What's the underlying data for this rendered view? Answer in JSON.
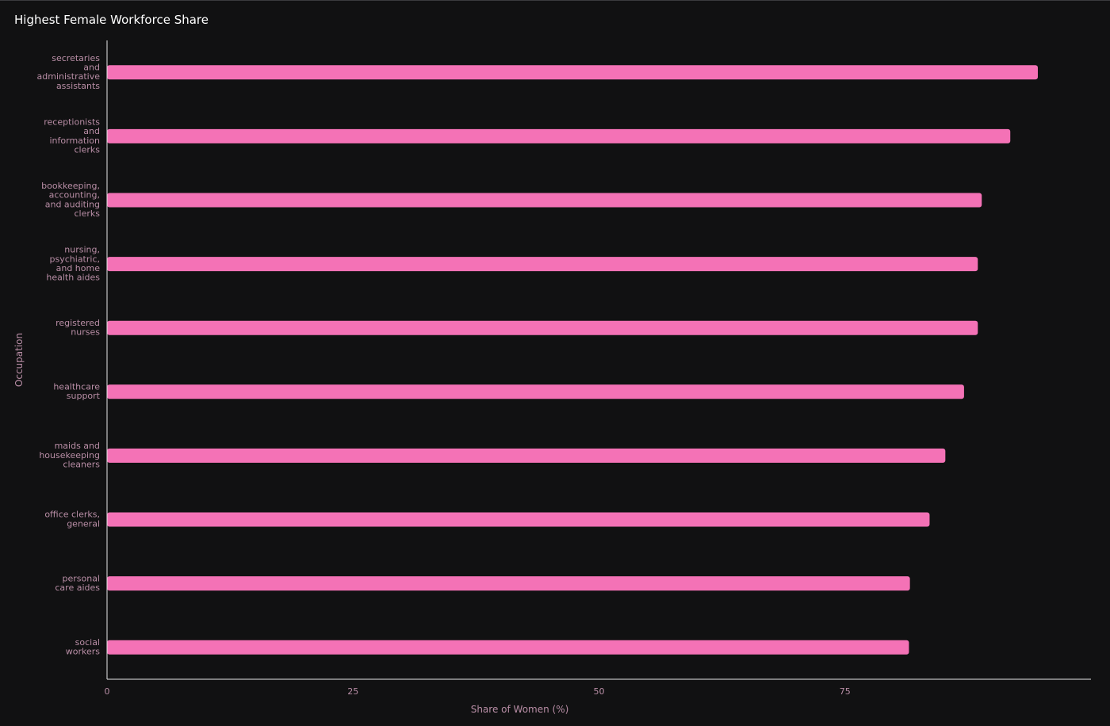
{
  "chart_data": {
    "type": "bar",
    "orientation": "horizontal",
    "title": "Highest Female Workforce Share",
    "xlabel": "Share of Women (%)",
    "ylabel": "Occupation",
    "xlim": [
      0,
      100
    ],
    "x_ticks": [
      "0",
      "25",
      "50",
      "75"
    ],
    "bar_color": "#f472b6",
    "grid": false,
    "legend": "none",
    "categories": [
      [
        "secretaries",
        "and",
        "administrative",
        "assistants"
      ],
      [
        "receptionists",
        "and",
        "information",
        "clerks"
      ],
      [
        "bookkeeping,",
        "accounting,",
        "and auditing",
        "clerks"
      ],
      [
        "nursing,",
        "psychiatric,",
        "and home",
        "health aides"
      ],
      [
        "registered",
        "nurses"
      ],
      [
        "healthcare",
        "support"
      ],
      [
        "maids and",
        "housekeeping",
        "cleaners"
      ],
      [
        "office clerks,",
        "general"
      ],
      [
        "personal",
        "care aides"
      ],
      [
        "social",
        "workers"
      ]
    ],
    "values": [
      94.6,
      91.8,
      88.9,
      88.5,
      88.5,
      87.1,
      85.2,
      83.6,
      81.6,
      81.5
    ]
  }
}
